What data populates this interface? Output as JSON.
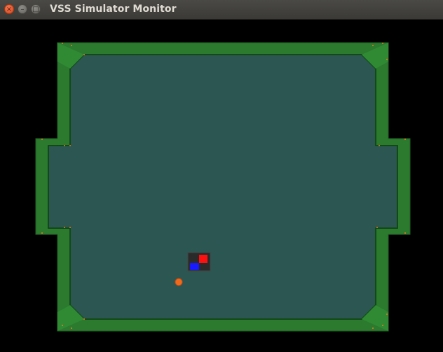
{
  "window": {
    "title": "VSS Simulator Monitor",
    "buttons": {
      "close_glyph": "×",
      "minimize_glyph": "–",
      "maximize_glyph": "□"
    }
  },
  "colors": {
    "background": "#000000",
    "field": "#2c5652",
    "wall": "#2b7a2e",
    "wall_dark": "#14561a",
    "ball": "#f06a1e",
    "robot_body": "#2a2a2a",
    "team_color": "#1a1aff",
    "id_color": "#ff1010"
  }
}
